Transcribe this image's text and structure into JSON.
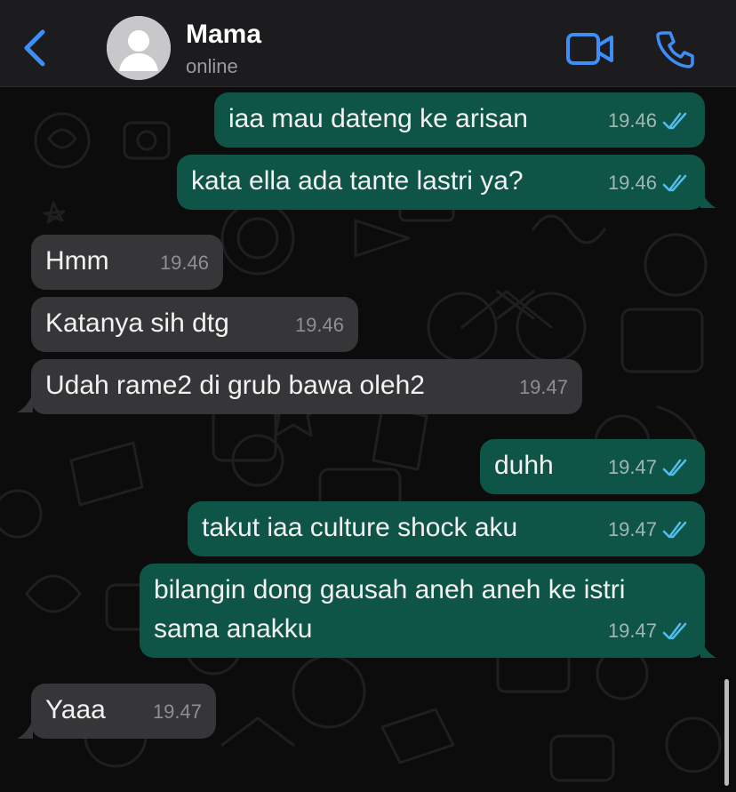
{
  "header": {
    "contact_name": "Mama",
    "status": "online"
  },
  "colors": {
    "accent": "#3e8ef7",
    "outgoing_bubble": "#0f5547",
    "incoming_bubble": "#363638",
    "read_ticks": "#53bdeb"
  },
  "icons": {
    "back": "chevron-left-icon",
    "video": "video-camera-icon",
    "call": "phone-icon",
    "read": "double-check-icon"
  },
  "messages": [
    {
      "dir": "out",
      "text": "iaa mau dateng ke arisan",
      "time": "19.46",
      "read": true
    },
    {
      "dir": "out",
      "text": "kata ella ada tante lastri ya?",
      "time": "19.46",
      "read": true
    },
    {
      "dir": "in",
      "text": "Hmm",
      "time": "19.46"
    },
    {
      "dir": "in",
      "text": "Katanya sih dtg",
      "time": "19.46"
    },
    {
      "dir": "in",
      "text": "Udah rame2 di grub bawa oleh2",
      "time": "19.47"
    },
    {
      "dir": "out",
      "text": "duhh",
      "time": "19.47",
      "read": true
    },
    {
      "dir": "out",
      "text": "takut iaa culture shock aku",
      "time": "19.47",
      "read": true
    },
    {
      "dir": "out",
      "text": "bilangin dong gausah aneh aneh ke istri\nsama anakku",
      "time": "19.47",
      "read": true
    },
    {
      "dir": "in",
      "text": "Yaaa",
      "time": "19.47"
    }
  ]
}
